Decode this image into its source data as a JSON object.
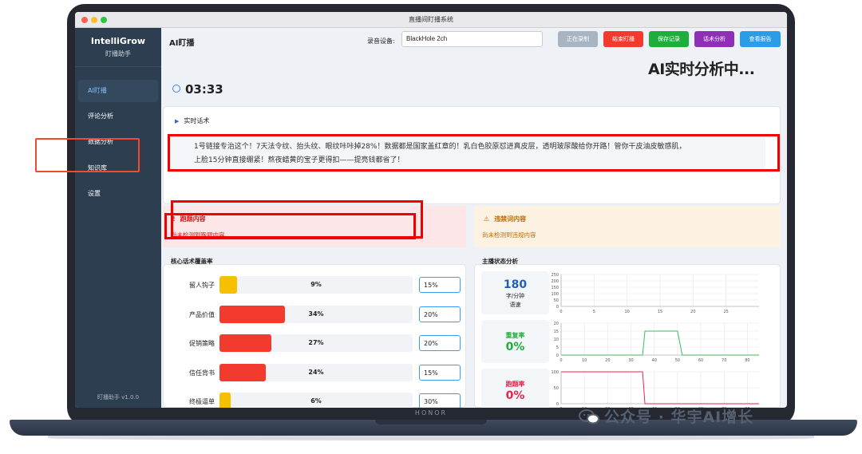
{
  "window": {
    "title": "直播间盯播系统"
  },
  "sidebar": {
    "app_name": "IntelliGrow",
    "subtitle": "盯播助手",
    "items": [
      {
        "label": "AI盯播",
        "active": true
      },
      {
        "label": "评论分析",
        "active": false
      },
      {
        "label": "数据分析",
        "active": false
      },
      {
        "label": "知识库",
        "active": false
      },
      {
        "label": "设置",
        "active": false
      }
    ],
    "version": "盯播助手 v1.0.0"
  },
  "header": {
    "title": "AI盯播",
    "device_label": "录音设备:",
    "device_value": "BlackHole 2ch",
    "buttons": [
      {
        "label": "正在录制",
        "color": "#a8b4c2"
      },
      {
        "label": "结束盯播",
        "color": "#f23a2e"
      },
      {
        "label": "保存记录",
        "color": "#1eae3c"
      },
      {
        "label": "话术分析",
        "color": "#8e2fb6"
      },
      {
        "label": "查看报告",
        "color": "#2b9ce8"
      }
    ]
  },
  "status_text": "AI实时分析中...",
  "timer": "03:33",
  "realtime": {
    "heading": "实时话术",
    "line1": "1号链接专治这个！7天法令纹、抬头纹、眼纹咔咔掉28%！数据都是国家盖红章的！乳白色胶原怼进真皮层，透明玻尿酸给你开路！管你干皮油皮敏感肌，",
    "line2": "上脸15分钟直接绷紧！熬夜蜡黄的宝子更得扣——提亮钱都省了！"
  },
  "alerts": {
    "off_topic": {
      "title": "跑题内容",
      "body": "尚未检测到跑题内容",
      "icon": "!"
    },
    "banned": {
      "title": "违禁词内容",
      "body": "尚未检测到违规内容",
      "icon": "warning-icon"
    }
  },
  "coverage": {
    "title": "核心话术覆盖率",
    "rows": [
      {
        "label": "留人钩子",
        "pct": "9%",
        "value": 9,
        "target": "15%",
        "color": "#f6c000"
      },
      {
        "label": "产品价值",
        "pct": "34%",
        "value": 34,
        "target": "20%",
        "color": "#f23a2e"
      },
      {
        "label": "促销策略",
        "pct": "27%",
        "value": 27,
        "target": "20%",
        "color": "#f23a2e"
      },
      {
        "label": "信任背书",
        "pct": "24%",
        "value": 24,
        "target": "15%",
        "color": "#f23a2e"
      },
      {
        "label": "终极逼单",
        "pct": "6%",
        "value": 6,
        "target": "30%",
        "color": "#f6c000"
      }
    ]
  },
  "anchor": {
    "title": "主播状态分析",
    "speed": {
      "value": "180",
      "unit": "字/分钟",
      "label": "语速",
      "color": "#1f5fb5"
    },
    "repeat": {
      "label": "重复率",
      "value": "0%",
      "color": "#1eae3c"
    },
    "offtopic": {
      "label": "跑题率",
      "value": "0%",
      "color": "#e8234a"
    }
  },
  "chart_data": [
    {
      "type": "line",
      "x": [
        0,
        30
      ],
      "y": [],
      "ylim": [
        0,
        250
      ],
      "xticks": [
        "0",
        "5",
        "10",
        "15",
        "20",
        "25"
      ],
      "yticks": [
        "0",
        "50",
        "100",
        "150",
        "200",
        "250"
      ],
      "grid": true
    },
    {
      "type": "line",
      "x": [
        0,
        5,
        10,
        15,
        20,
        25,
        30,
        35,
        36,
        40,
        45,
        50,
        52,
        55,
        60,
        65,
        70,
        75,
        80,
        85
      ],
      "y": [
        0,
        0,
        0,
        0,
        0,
        0,
        0,
        0,
        15,
        15,
        15,
        15,
        0,
        0,
        0,
        0,
        0,
        0,
        0,
        0
      ],
      "color": "#3cba5e",
      "ylim": [
        0,
        20
      ],
      "xticks": [
        "0",
        "10",
        "20",
        "30",
        "40",
        "50",
        "60",
        "70",
        "80"
      ],
      "yticks": [
        "0",
        "5",
        "10",
        "15",
        "20"
      ],
      "grid": true
    },
    {
      "type": "line",
      "x": [
        0,
        5,
        10,
        15,
        20,
        25,
        30,
        35,
        36,
        40,
        45,
        50,
        55,
        60,
        65,
        70,
        75,
        80,
        85
      ],
      "y": [
        100,
        100,
        100,
        100,
        100,
        100,
        100,
        100,
        0,
        0,
        0,
        0,
        0,
        0,
        0,
        0,
        0,
        0,
        0
      ],
      "color": "#e8234a",
      "ylim": [
        0,
        100
      ],
      "xticks": [
        "0",
        "10",
        "20",
        "30",
        "40",
        "50",
        "60",
        "70",
        "80"
      ],
      "yticks": [
        "0",
        "50",
        "100"
      ],
      "grid": true
    }
  ],
  "device_brand": "HONOR",
  "watermark": "公众号 · 华宇AI增长"
}
